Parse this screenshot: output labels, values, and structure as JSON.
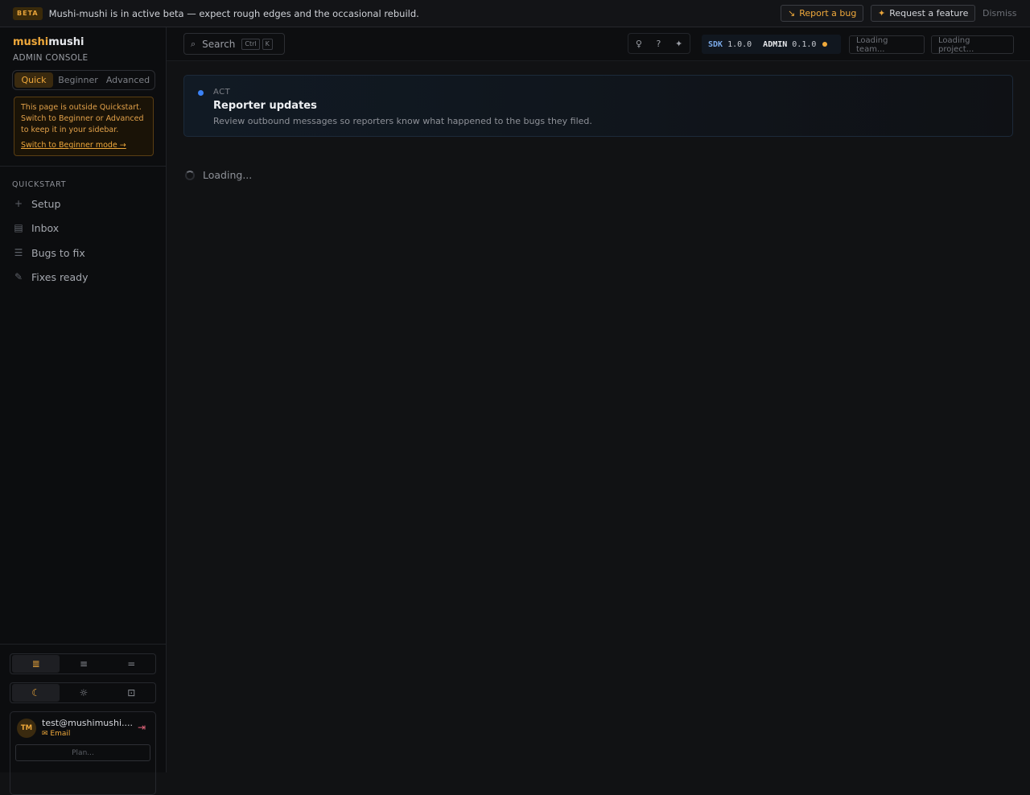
{
  "banner": {
    "badge": "BETA",
    "text": "Mushi-mushi is in active beta — expect rough edges and the occasional rebuild.",
    "report_bug": "Report a bug",
    "request_feature": "Request a feature",
    "dismiss": "Dismiss"
  },
  "sidebar": {
    "brand_part1": "mushi",
    "brand_part2": "mushi",
    "subtitle": "ADMIN CONSOLE",
    "modes": [
      "Quick",
      "Beginner",
      "Advanced"
    ],
    "notice_text": "This page is outside Quickstart. Switch to Beginner or Advanced to keep it in your sidebar.",
    "notice_link": "Switch to Beginner mode →",
    "section": "QUICKSTART",
    "items": [
      {
        "label": "Setup",
        "icon": "plus-icon"
      },
      {
        "label": "Inbox",
        "icon": "inbox-icon"
      },
      {
        "label": "Bugs to fix",
        "icon": "list-icon"
      },
      {
        "label": "Fixes ready",
        "icon": "wrench-icon"
      }
    ],
    "user": {
      "initials": "TM",
      "email": "test@mushimushi....",
      "method": "Email",
      "plan": "Plan..."
    }
  },
  "topbar": {
    "search_label": "Search",
    "kbd1": "Ctrl",
    "kbd2": "K",
    "sdk_label": "SDK",
    "sdk_version": "1.0.0",
    "admin_label": "ADMIN",
    "admin_version": "0.1.0",
    "team": "Loading team...",
    "project": "Loading project..."
  },
  "main": {
    "kicker": "ACT",
    "title": "Reporter updates",
    "subtitle": "Review outbound messages so reporters know what happened to the bugs they filed.",
    "loading": "Loading..."
  },
  "colors": {
    "accent": "#f0a93b",
    "blue": "#3b82f6",
    "danger": "#e0647a"
  }
}
